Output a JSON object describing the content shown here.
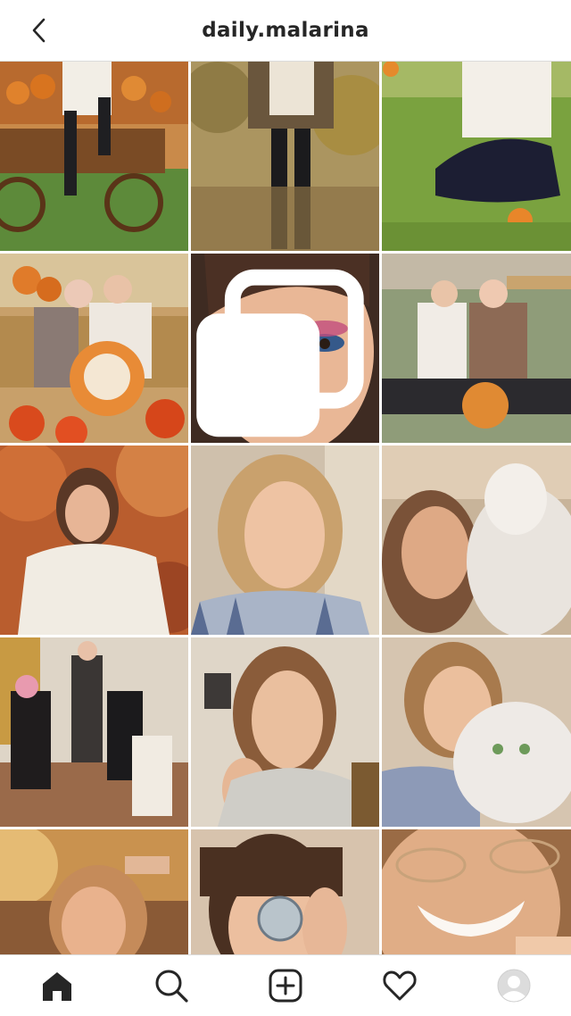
{
  "header": {
    "title": "daily.malarina",
    "back_icon": "chevron-left-icon"
  },
  "grid": {
    "posts": [
      {
        "name": "pumpkin-wagon",
        "multi": false
      },
      {
        "name": "autumn-walk",
        "multi": false
      },
      {
        "name": "grass-sitting",
        "multi": false
      },
      {
        "name": "pumpkin-patch-duo",
        "multi": false
      },
      {
        "name": "makeup-closeup",
        "multi": true
      },
      {
        "name": "sitting-duo-pumpkin",
        "multi": false
      },
      {
        "name": "autumn-sweater",
        "multi": false
      },
      {
        "name": "selfie-striped-shirt",
        "multi": false
      },
      {
        "name": "cat-selfie",
        "multi": false
      },
      {
        "name": "party-group",
        "multi": false
      },
      {
        "name": "selfie-hand-chin",
        "multi": false
      },
      {
        "name": "holding-white-cat",
        "multi": false
      },
      {
        "name": "sunset-portrait",
        "multi": false
      },
      {
        "name": "glass-ball",
        "multi": false
      },
      {
        "name": "necklace-smile",
        "multi": false
      }
    ]
  },
  "bottom_nav": {
    "items": [
      "home-icon",
      "search-icon",
      "add-post-icon",
      "heart-icon",
      "profile-avatar"
    ],
    "active": "home-icon"
  },
  "colors": {
    "header_text": "#262626",
    "divider": "#dbdbdb",
    "icon": "#262626"
  }
}
